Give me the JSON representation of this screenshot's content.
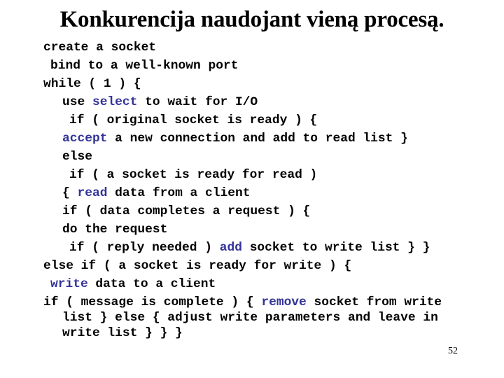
{
  "slide": {
    "title": "Konkurencija naudojant vieną procesą.",
    "page_number": "52",
    "keyword_color": "#333399"
  },
  "code": {
    "lines": [
      {
        "indent": 0,
        "parts": [
          {
            "t": "create a socket",
            "kw": false
          }
        ]
      },
      {
        "indent": 1,
        "parts": [
          {
            "t": "bind to a well-known port",
            "kw": false
          }
        ]
      },
      {
        "indent": 0,
        "parts": [
          {
            "t": "while ( 1 ) {",
            "kw": false
          }
        ]
      },
      {
        "indent": 2,
        "parts": [
          {
            "t": "use ",
            "kw": false
          },
          {
            "t": "select",
            "kw": true
          },
          {
            "t": " to wait for I/O",
            "kw": false
          }
        ]
      },
      {
        "indent": 3,
        "parts": [
          {
            "t": "if ( original socket is ready ) {",
            "kw": false
          }
        ]
      },
      {
        "indent": 2,
        "parts": [
          {
            "t": "accept",
            "kw": true
          },
          {
            "t": " a new connection and add to read list }",
            "kw": false
          }
        ]
      },
      {
        "indent": 2,
        "parts": [
          {
            "t": "else",
            "kw": false
          }
        ]
      },
      {
        "indent": 3,
        "parts": [
          {
            "t": "if ( a socket is ready for read )",
            "kw": false
          }
        ]
      },
      {
        "indent": 2,
        "parts": [
          {
            "t": "{ ",
            "kw": false
          },
          {
            "t": "read",
            "kw": true
          },
          {
            "t": " data from a client",
            "kw": false
          }
        ]
      },
      {
        "indent": 2,
        "parts": [
          {
            "t": "if ( data completes a request ) {",
            "kw": false
          }
        ]
      },
      {
        "indent": 2,
        "parts": [
          {
            "t": "do the request",
            "kw": false
          }
        ]
      },
      {
        "indent": 3,
        "parts": [
          {
            "t": "if ( reply needed ) ",
            "kw": false
          },
          {
            "t": "add",
            "kw": true
          },
          {
            "t": " socket to write list } }",
            "kw": false
          }
        ]
      },
      {
        "indent": 0,
        "parts": [
          {
            "t": "else if ( a socket is ready for write ) {",
            "kw": false
          }
        ]
      },
      {
        "indent": 1,
        "parts": [
          {
            "t": "write",
            "kw": true
          },
          {
            "t": " data to a client",
            "kw": false
          }
        ]
      },
      {
        "indent": 0,
        "wrap": true,
        "parts": [
          {
            "t": "if ( message is complete ) { ",
            "kw": false
          },
          {
            "t": "remove",
            "kw": true
          },
          {
            "t": " socket from write",
            "kw": false
          }
        ]
      },
      {
        "indent": 2,
        "wrap": true,
        "parts": [
          {
            "t": "list } else { adjust write parameters and leave in",
            "kw": false
          }
        ]
      },
      {
        "indent": 2,
        "parts": [
          {
            "t": "write list } } }",
            "kw": false
          }
        ]
      }
    ]
  }
}
